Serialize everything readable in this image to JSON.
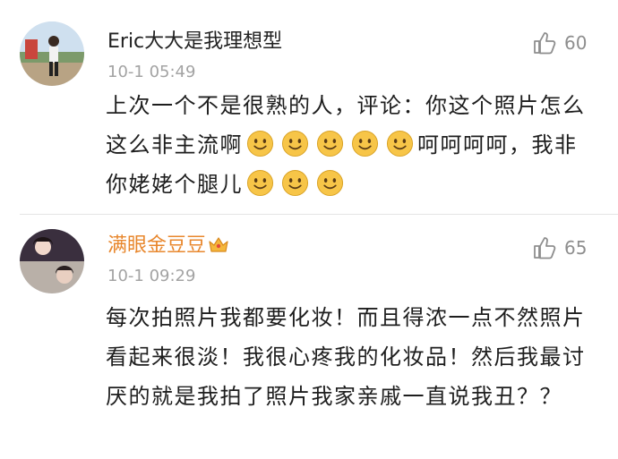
{
  "comments": [
    {
      "username": "Eric大大是我理想型",
      "timestamp": "10-1 05:49",
      "likes": "60",
      "text_1": "上次一个不是很熟的人，评论：你这个照片怎么这么非主流啊",
      "text_2": "呵呵呵呵，我非你姥姥个腿儿",
      "emoji_count_1": 5,
      "emoji_count_2": 3,
      "emoji": "smile-emoji"
    },
    {
      "username": "满眼金豆豆",
      "username_color": "#e8872d",
      "badge": "crown-icon",
      "timestamp": "10-1 09:29",
      "likes": "65",
      "text": "每次拍照片我都要化妆！而且得浓一点不然照片看起来很淡！我很心疼我的化妆品！然后我最讨厌的就是我拍了照片我家亲戚一直说我丑？？"
    }
  ],
  "colors": {
    "timestamp": "#a3a3a3",
    "like": "#8e8e8e",
    "divider": "#e4e4e4",
    "emoji_face": "#f7c548"
  }
}
